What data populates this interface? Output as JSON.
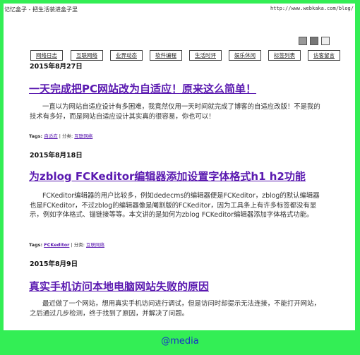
{
  "header": {
    "site_title": "记忆盒子 - 把生活装进盒子里",
    "site_url": "http://www.webkaka.com/blog/"
  },
  "nav": {
    "items": [
      {
        "label": "网络日志"
      },
      {
        "label": "互联网络"
      },
      {
        "label": "业界动态"
      },
      {
        "label": "软件编程"
      },
      {
        "label": "生活时评"
      },
      {
        "label": "娱乐休闲"
      },
      {
        "label": "标签列表"
      },
      {
        "label": "访客留言"
      }
    ]
  },
  "posts": [
    {
      "date": "2015年8月27日",
      "title": "一天完成把PC网站改为自适应！原来这么简单！",
      "excerpt": "一直以为网站自适应设计有多困难，我竟然仅用一天时间就完成了博客的自适应改版！不是我的技术有多好，而是网站自适应设计其实真的很容易，你也可以！",
      "tags_label": "Tags:",
      "tag": "自适应",
      "category_label": "| 分类:",
      "category": "互联网络"
    },
    {
      "date": "2015年8月18日",
      "title": "为zblog FCKeditor编辑器添加设置字体格式h1 h2功能",
      "excerpt": "FCKeditor编辑器的用户比较多，例如dedecms的编辑器便是FCKeditor，zblog的默认编辑器也是FCKeditor，不过zblog的编辑器像是阉割版的FCKeditor，因为工具条上有许多标签都没有显示，例如字体格式、锚链接等等。本文讲的是如何为zblog FCKeditor编辑器添加字体格式功能。",
      "tags_label": "Tags:",
      "tag": "FCKeditor",
      "category_label": "| 分类:",
      "category": "互联网络"
    },
    {
      "date": "2015年8月9日",
      "title": "真实手机访问本地电脑网站失败的原因",
      "excerpt": "最近做了一个网站，想用真实手机访问进行调试，但是访问时却提示无法连接，不能打开网站，之后通过几步检测，终于找到了原因，并解决了问题。"
    }
  ],
  "footer": {
    "media_label": "@media"
  },
  "colors": {
    "background": "#33ee55",
    "link": "#5a19b0",
    "media": "#1a30c8"
  }
}
